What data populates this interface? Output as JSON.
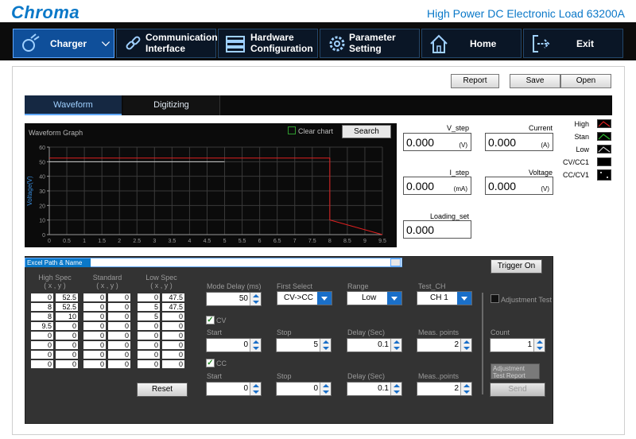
{
  "header": {
    "logo": "Chroma",
    "title": "High Power DC Electronic Load 63200A"
  },
  "nav": [
    {
      "label": "Charger",
      "icon": "charger-icon"
    },
    {
      "label": "Communication\nInterface",
      "icon": "link-icon"
    },
    {
      "label": "Hardware\nConfiguration",
      "icon": "hardware-icon"
    },
    {
      "label": "Parameter\nSetting",
      "icon": "gear-icon"
    },
    {
      "label": "Home",
      "icon": "home-icon"
    },
    {
      "label": "Exit",
      "icon": "exit-icon"
    }
  ],
  "toolbar": {
    "report": "Report",
    "save": "Save",
    "open": "Open"
  },
  "tabs": {
    "waveform": "Waveform",
    "digitizing": "Digitizing"
  },
  "graph": {
    "title": "Waveform Graph",
    "clear_chart": "Clear chart",
    "search": "Search",
    "ylabel": "Voltage(V)",
    "yticks": [
      "0",
      "10",
      "20",
      "30",
      "40",
      "50",
      "60"
    ],
    "xticks": [
      "0",
      "0.5",
      "1",
      "1.5",
      "2",
      "2.5",
      "3",
      "3.5",
      "4",
      "4.5",
      "5",
      "5.5",
      "6",
      "6.5",
      "7",
      "7.5",
      "8",
      "8.5",
      "9",
      "9.5"
    ]
  },
  "chart_data": {
    "type": "line",
    "xlabel": "",
    "ylabel": "Voltage(V)",
    "xlim": [
      0,
      9.5
    ],
    "ylim": [
      0,
      60
    ],
    "series": [
      {
        "name": "High",
        "color": "#e02020",
        "x": [
          0,
          8,
          8,
          9.5
        ],
        "y": [
          52.5,
          52.5,
          10,
          0
        ]
      },
      {
        "name": "Stan",
        "color": "#cfcfcf",
        "x": [
          0,
          5
        ],
        "y": [
          50,
          50
        ]
      }
    ]
  },
  "meas": {
    "v_step": {
      "label": "V_step",
      "value": "0.000",
      "unit": "(V)"
    },
    "current": {
      "label": "Current",
      "value": "0.000",
      "unit": "(A)"
    },
    "i_step": {
      "label": "I_step",
      "value": "0.000",
      "unit": "(mA)"
    },
    "voltage": {
      "label": "Voltage",
      "value": "0.000",
      "unit": "(V)"
    },
    "loading_set": {
      "label": "Loading_set",
      "value": "0.000"
    }
  },
  "legend": [
    {
      "label": "High",
      "color": "#e02020"
    },
    {
      "label": "Stan",
      "color": "#2fbf2f"
    },
    {
      "label": "Low",
      "color": "#cfcfcf"
    },
    {
      "label": "CV/CC1",
      "color": "#000000"
    },
    {
      "label": "CC/CV1",
      "color": "#ffffff"
    }
  ],
  "lower": {
    "excel_label": "Excel Path & Name",
    "trigger_on": "Trigger On",
    "high_spec": "High Spec",
    "standard": "Standard",
    "low_spec": "Low Spec",
    "xy": "( x , y )",
    "high_rows": [
      [
        "0",
        "52.5"
      ],
      [
        "8",
        "52.5"
      ],
      [
        "8",
        "10"
      ],
      [
        "9.5",
        "0"
      ],
      [
        "0",
        "0"
      ],
      [
        "0",
        "0"
      ],
      [
        "0",
        "0"
      ],
      [
        "0",
        "0"
      ]
    ],
    "std_rows": [
      [
        "0",
        "0"
      ],
      [
        "0",
        "0"
      ],
      [
        "0",
        "0"
      ],
      [
        "0",
        "0"
      ],
      [
        "0",
        "0"
      ],
      [
        "0",
        "0"
      ],
      [
        "0",
        "0"
      ],
      [
        "0",
        "0"
      ]
    ],
    "low_rows": [
      [
        "0",
        "47.5"
      ],
      [
        "5",
        "47.5"
      ],
      [
        "5",
        "0"
      ],
      [
        "0",
        "0"
      ],
      [
        "0",
        "0"
      ],
      [
        "0",
        "0"
      ],
      [
        "0",
        "0"
      ],
      [
        "0",
        "0"
      ]
    ],
    "reset": "Reset",
    "mode_delay_label": "Mode Delay (ms)",
    "mode_delay": "50",
    "first_select_label": "First Select",
    "first_select": "CV->CC",
    "range_label": "Range",
    "range": "Low",
    "test_ch_label": "Test_CH",
    "test_ch": "CH 1",
    "cv_label": "CV",
    "cc_label": "CC",
    "start_label": "Start",
    "stop_label": "Stop",
    "delay_label": "Delay  (Sec)",
    "delay_label2": "Delay (Sec)",
    "meas_points_label": "Meas. points",
    "meas_points_label2": "Meas..points",
    "cv_start": "0",
    "cv_stop": "5",
    "cv_delay": "0.1",
    "cv_points": "2",
    "cc_start": "0",
    "cc_stop": "0",
    "cc_delay": "0.1",
    "cc_points": "2",
    "adjustment_test": "Adjustment Test",
    "count_label": "Count",
    "count": "1",
    "adj_report": "Adjustment Test Report",
    "send": "Send"
  }
}
